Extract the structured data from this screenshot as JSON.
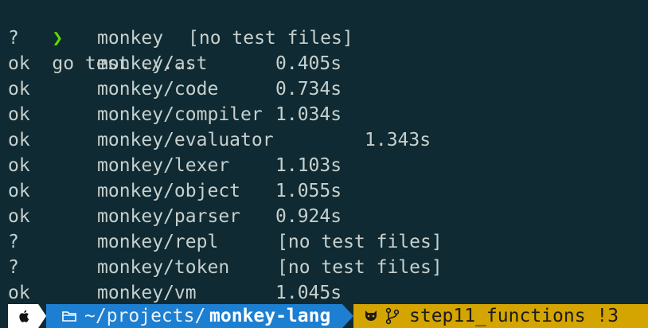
{
  "prompt": {
    "symbol": "❯",
    "command": "go test ./..."
  },
  "results": [
    {
      "status": "?",
      "package": "monkey",
      "result": "[no test files]",
      "inline": true
    },
    {
      "status": "ok",
      "package": "monkey/ast",
      "result": "0.405s"
    },
    {
      "status": "ok",
      "package": "monkey/code",
      "result": "0.734s"
    },
    {
      "status": "ok",
      "package": "monkey/compiler",
      "result": "1.034s"
    },
    {
      "status": "ok",
      "package": "monkey/evaluator",
      "result": "1.343s",
      "far": true
    },
    {
      "status": "ok",
      "package": "monkey/lexer",
      "result": "1.103s"
    },
    {
      "status": "ok",
      "package": "monkey/object",
      "result": "1.055s"
    },
    {
      "status": "ok",
      "package": "monkey/parser",
      "result": "0.924s"
    },
    {
      "status": "?",
      "package": "monkey/repl",
      "result": "[no test files]"
    },
    {
      "status": "?",
      "package": "monkey/token",
      "result": "[no test files]"
    },
    {
      "status": "ok",
      "package": "monkey/vm",
      "result": "1.045s"
    }
  ],
  "statusbar": {
    "os_icon": "apple-icon",
    "folder_icon": "folder-icon",
    "path_prefix": "~/projects/",
    "path_current": "monkey-lang",
    "git_icon": "github-octocat-icon",
    "branch_icon": "git-branch-icon",
    "branch": "step11_functions !3",
    "colors": {
      "os_bg": "#ffffff",
      "path_bg": "#1d7fd1",
      "git_bg": "#d4a400",
      "terminal_bg": "#0f2a33"
    }
  }
}
